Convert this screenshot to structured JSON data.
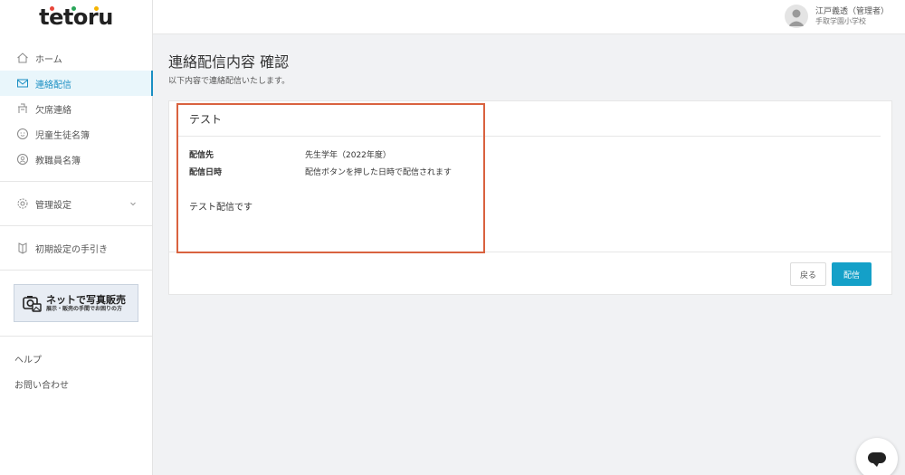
{
  "logo": {
    "text": "tetoru",
    "dot_colors": [
      "#e8463a",
      "#2aa65a",
      "#f5b400"
    ]
  },
  "sidebar": {
    "items": [
      {
        "label": "ホーム",
        "icon": "home-icon"
      },
      {
        "label": "連絡配信",
        "icon": "mail-icon",
        "active": true
      },
      {
        "label": "欠席連絡",
        "icon": "desk-icon"
      },
      {
        "label": "児童生徒名簿",
        "icon": "student-icon"
      },
      {
        "label": "教職員名簿",
        "icon": "teacher-icon"
      }
    ],
    "settings_label": "管理設定",
    "guide_label": "初期設定の手引き",
    "photo_banner": {
      "title": "ネットで写真販売",
      "subtitle": "展示・販売の手間でお困りの方"
    },
    "help_label": "ヘルプ",
    "contact_label": "お問い合わせ"
  },
  "header": {
    "user_name": "江戸義透（管理者）",
    "school": "手取学園小学校"
  },
  "main": {
    "title": "連絡配信内容 確認",
    "subtitle": "以下内容で連絡配信いたします。",
    "card": {
      "title": "テスト",
      "fields": [
        {
          "key": "配信先",
          "value": "先生学年（2022年度）"
        },
        {
          "key": "配信日時",
          "value": "配信ボタンを押した日時で配信されます"
        }
      ],
      "body": "テスト配信です"
    },
    "back_label": "戻る",
    "send_label": "配信"
  },
  "colors": {
    "accent": "#14a0c8",
    "highlight": "#d9623f",
    "active_bg": "#e9f6fb"
  }
}
